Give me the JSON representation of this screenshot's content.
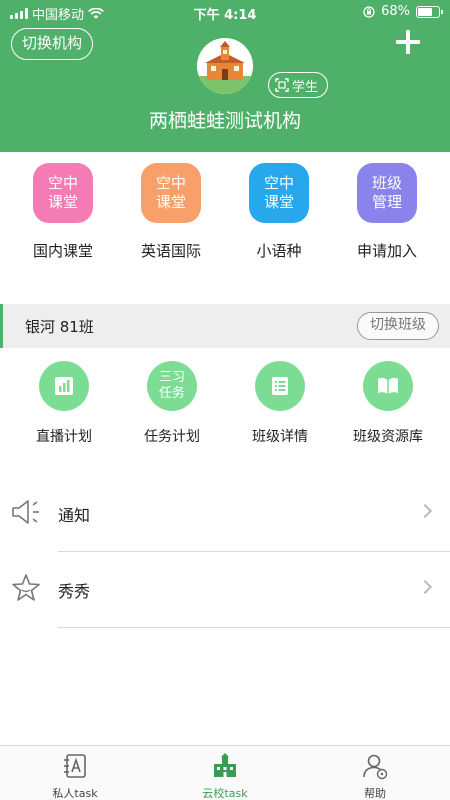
{
  "status_bar": {
    "carrier": "中国移动",
    "time": "下午 4:14",
    "battery_percent": "68%",
    "battery_level": 0.68
  },
  "header": {
    "switch_org_label": "切换机构",
    "add_icon": "plus-icon",
    "avatar_icon": "school-building-avatar",
    "role_label": "学生",
    "org_name": "两栖蛙蛙测试机构",
    "bg_color": "#4fb06a"
  },
  "categories": [
    {
      "tile_text": "空中\n课堂",
      "label": "国内课堂",
      "color": "#f57bb4"
    },
    {
      "tile_text": "空中\n课堂",
      "label": "英语国际",
      "color": "#f7a06a"
    },
    {
      "tile_text": "空中\n课堂",
      "label": "小语种",
      "color": "#27a7ec"
    },
    {
      "tile_text": "班级\n管理",
      "label": "申请加入",
      "color": "#8a83ec"
    }
  ],
  "class_bar": {
    "class_name": "银河 81班",
    "switch_class_label": "切换班级"
  },
  "class_functions": [
    {
      "icon": "bar-chart-icon",
      "icon_text": "",
      "label": "直播计划"
    },
    {
      "icon": "task-text-icon",
      "icon_text": "三习\n任务",
      "label": "任务计划"
    },
    {
      "icon": "list-icon",
      "icon_text": "",
      "label": "班级详情"
    },
    {
      "icon": "book-icon",
      "icon_text": "",
      "label": "班级资源库"
    }
  ],
  "list": [
    {
      "icon": "speaker-icon",
      "title": "通知"
    },
    {
      "icon": "star-icon",
      "title": "秀秀"
    }
  ],
  "tab_bar": {
    "tabs": [
      {
        "icon": "notebook-icon",
        "label": "私人task",
        "active": false
      },
      {
        "icon": "school-icon",
        "label": "云校task",
        "active": true
      },
      {
        "icon": "user-help-icon",
        "label": "帮助",
        "active": false
      }
    ],
    "active_color": "#3a9b52"
  }
}
